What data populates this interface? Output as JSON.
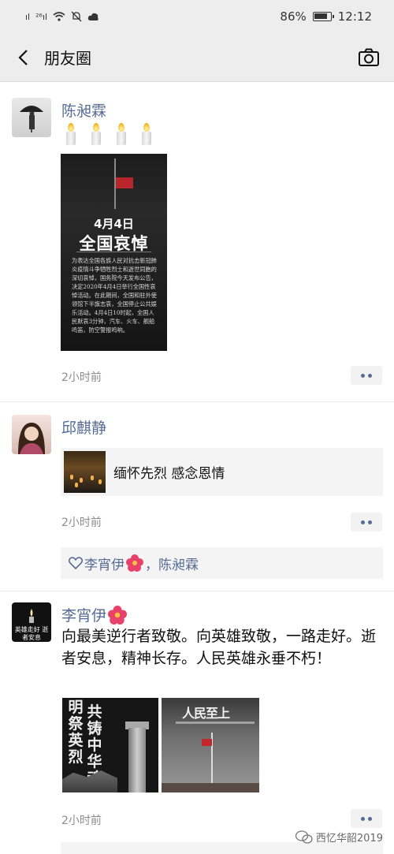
{
  "status_bar": {
    "signal_1": "ıl",
    "signal_2": "²⁶ıl",
    "battery_percent": "86%",
    "time": "12:12"
  },
  "nav": {
    "title": "朋友圈"
  },
  "posts": [
    {
      "name": "陈昶霖",
      "candle_count": 4,
      "image": {
        "date": "4月4日",
        "headline": "全国哀悼",
        "body": "为表达全国各族人民对抗击新冠肺炎疫情斗争牺牲烈士和逝世同胞的深切哀悼，国务院今天发布公告，决定2020年4月4日举行全国性哀悼活动。在此期间，全国和驻外使领馆下半旗志哀，全国停止公共娱乐活动。4月4日10时起，全国人民默哀3分钟，汽车、火车、舰船鸣笛，防空警报鸣响。"
      },
      "time": "2小时前"
    },
    {
      "name": "邱麒静",
      "link_title": "缅怀先烈 感念恩情",
      "time": "2小时前",
      "likes": {
        "first": "李宵伊",
        "second": "，陈昶霖"
      }
    },
    {
      "name": "李宵伊",
      "text": "向最美逆行者致敬。向英雄致敬，一路走好。逝者安息，精神长存。人民英雄永垂不朽！",
      "avatar_text": "英雄走好 逝者安息",
      "photos": [
        {
          "col_1": "明祭英烈",
          "col_2": "共铸中华魂"
        },
        {
          "title": "人民至上"
        }
      ],
      "time": "2小时前"
    }
  ],
  "watermark": "西忆华韶2019",
  "colors": {
    "name_link": "#576b95",
    "background_bar": "#ededed",
    "card_background": "#f4f4f4"
  }
}
